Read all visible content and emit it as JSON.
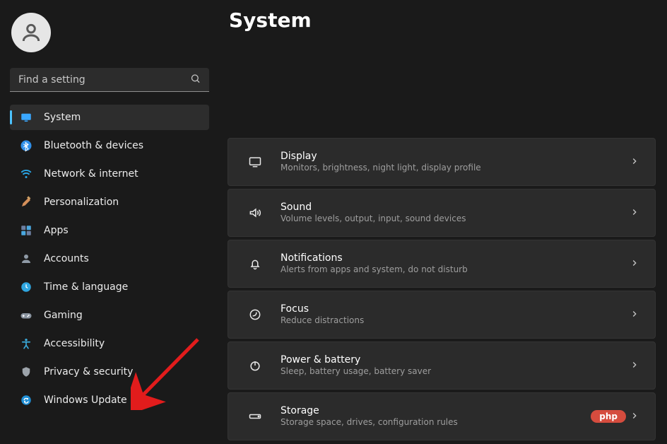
{
  "search": {
    "placeholder": "Find a setting"
  },
  "page_title": "System",
  "sidebar": [
    {
      "key": "system",
      "label": "System",
      "iconColor": "#3aa7ff"
    },
    {
      "key": "bluetooth",
      "label": "Bluetooth & devices",
      "iconColor": "#2f8fe9"
    },
    {
      "key": "network",
      "label": "Network & internet",
      "iconColor": "#2aa6e6"
    },
    {
      "key": "personalization",
      "label": "Personalization",
      "iconColor": "#d48f5a"
    },
    {
      "key": "apps",
      "label": "Apps",
      "iconColor": "#6c7fa1"
    },
    {
      "key": "accounts",
      "label": "Accounts",
      "iconColor": "#8f9aa6"
    },
    {
      "key": "time",
      "label": "Time & language",
      "iconColor": "#2fa6e0"
    },
    {
      "key": "gaming",
      "label": "Gaming",
      "iconColor": "#8a94a0"
    },
    {
      "key": "accessibility",
      "label": "Accessibility",
      "iconColor": "#3aa8d8"
    },
    {
      "key": "privacy",
      "label": "Privacy & security",
      "iconColor": "#9da4ab"
    },
    {
      "key": "update",
      "label": "Windows Update",
      "iconColor": "#1f8fd6"
    }
  ],
  "selected_sidebar_key": "system",
  "cards": [
    {
      "key": "display",
      "title": "Display",
      "sub": "Monitors, brightness, night light, display profile"
    },
    {
      "key": "sound",
      "title": "Sound",
      "sub": "Volume levels, output, input, sound devices"
    },
    {
      "key": "notifications",
      "title": "Notifications",
      "sub": "Alerts from apps and system, do not disturb"
    },
    {
      "key": "focus",
      "title": "Focus",
      "sub": "Reduce distractions"
    },
    {
      "key": "power",
      "title": "Power & battery",
      "sub": "Sleep, battery usage, battery saver"
    },
    {
      "key": "storage",
      "title": "Storage",
      "sub": "Storage space, drives, configuration rules"
    }
  ],
  "watermark": "php"
}
